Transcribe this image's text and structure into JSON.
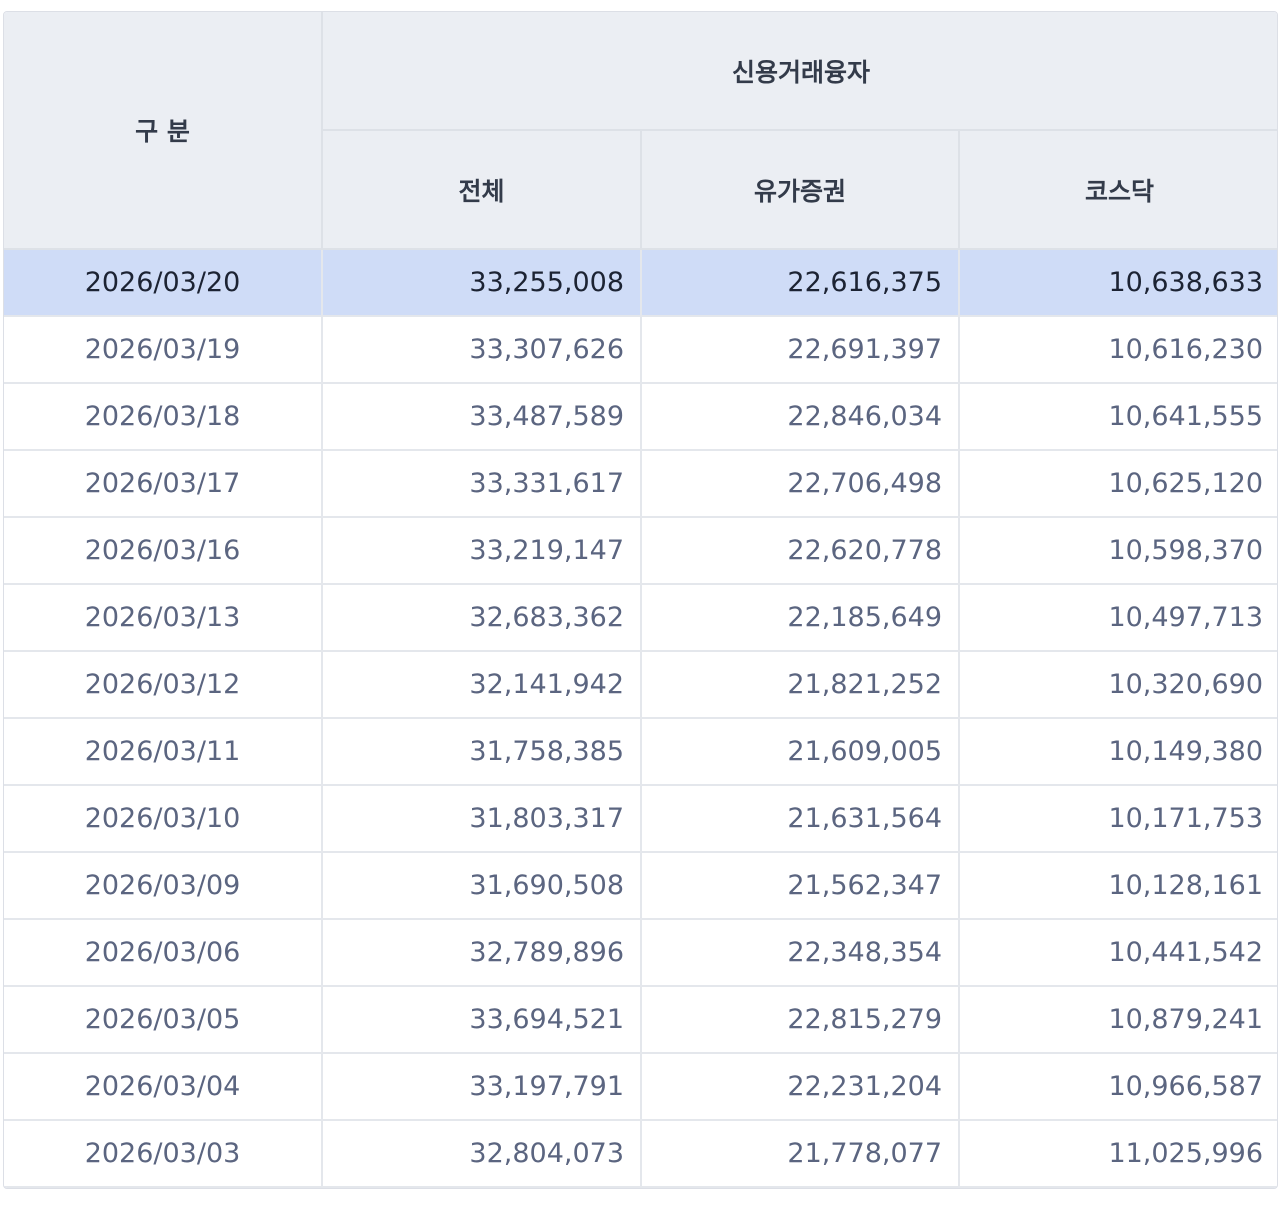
{
  "header": {
    "category": "구 분",
    "group": "신용거래융자",
    "columns": [
      "전체",
      "유가증권",
      "코스닥"
    ]
  },
  "rows": [
    {
      "date": "2026/03/20",
      "total": "33,255,008",
      "kospi": "22,616,375",
      "kosdaq": "10,638,633",
      "selected": true
    },
    {
      "date": "2026/03/19",
      "total": "33,307,626",
      "kospi": "22,691,397",
      "kosdaq": "10,616,230"
    },
    {
      "date": "2026/03/18",
      "total": "33,487,589",
      "kospi": "22,846,034",
      "kosdaq": "10,641,555"
    },
    {
      "date": "2026/03/17",
      "total": "33,331,617",
      "kospi": "22,706,498",
      "kosdaq": "10,625,120"
    },
    {
      "date": "2026/03/16",
      "total": "33,219,147",
      "kospi": "22,620,778",
      "kosdaq": "10,598,370"
    },
    {
      "date": "2026/03/13",
      "total": "32,683,362",
      "kospi": "22,185,649",
      "kosdaq": "10,497,713"
    },
    {
      "date": "2026/03/12",
      "total": "32,141,942",
      "kospi": "21,821,252",
      "kosdaq": "10,320,690"
    },
    {
      "date": "2026/03/11",
      "total": "31,758,385",
      "kospi": "21,609,005",
      "kosdaq": "10,149,380"
    },
    {
      "date": "2026/03/10",
      "total": "31,803,317",
      "kospi": "21,631,564",
      "kosdaq": "10,171,753"
    },
    {
      "date": "2026/03/09",
      "total": "31,690,508",
      "kospi": "21,562,347",
      "kosdaq": "10,128,161"
    },
    {
      "date": "2026/03/06",
      "total": "32,789,896",
      "kospi": "22,348,354",
      "kosdaq": "10,441,542"
    },
    {
      "date": "2026/03/05",
      "total": "33,694,521",
      "kospi": "22,815,279",
      "kosdaq": "10,879,241"
    },
    {
      "date": "2026/03/04",
      "total": "33,197,791",
      "kospi": "22,231,204",
      "kosdaq": "10,966,587"
    },
    {
      "date": "2026/03/03",
      "total": "32,804,073",
      "kospi": "21,778,077",
      "kosdaq": "11,025,996"
    }
  ],
  "colors": {
    "header_bg": "#ebeef3",
    "selected_row_bg": "#cfdcf7",
    "text": "#5b6580"
  }
}
